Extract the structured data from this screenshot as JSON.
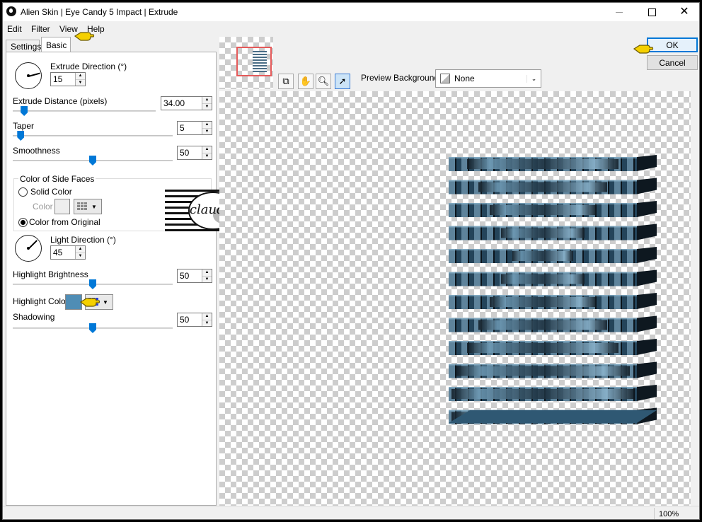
{
  "window": {
    "title": "Alien Skin | Eye Candy 5 Impact | Extrude"
  },
  "menu": [
    "Edit",
    "Filter",
    "View",
    "Help"
  ],
  "tabs": {
    "settings": "Settings",
    "basic": "Basic"
  },
  "controls": {
    "extrude_direction": {
      "label": "Extrude Direction (°)",
      "value": "15",
      "angle_degrees": 15
    },
    "extrude_distance": {
      "label": "Extrude Distance (pixels)",
      "value": "34.00",
      "slider_fraction": 0.08
    },
    "taper": {
      "label": "Taper",
      "value": "5",
      "slider_fraction": 0.05
    },
    "smoothness": {
      "label": "Smoothness",
      "value": "50",
      "slider_fraction": 0.5
    },
    "side_faces": {
      "group_label": "Color of Side Faces",
      "solid_label": "Solid Color",
      "color_label": "Color",
      "original_label": "Color from Original",
      "selected": "original",
      "solid_color": "#eeeeee"
    },
    "light_direction": {
      "label": "Light Direction (°)",
      "value": "45",
      "angle_degrees": 45
    },
    "highlight_brightness": {
      "label": "Highlight Brightness",
      "value": "50",
      "slider_fraction": 0.5
    },
    "highlight_color": {
      "label": "Highlight Color",
      "color": "#4f8db5"
    },
    "shadowing": {
      "label": "Shadowing",
      "value": "50",
      "slider_fraction": 0.5
    }
  },
  "watermark": {
    "text": "claudia"
  },
  "preview": {
    "background_label": "Preview Background:",
    "background_value": "None",
    "tools": [
      "preview-toggle-icon",
      "hand-icon",
      "zoom-icon",
      "pointer-icon"
    ],
    "object_colors": {
      "dark": "#0e1820",
      "mid": "#2f5873",
      "light": "#8db6cf"
    }
  },
  "buttons": {
    "ok": "OK",
    "cancel": "Cancel"
  },
  "status": {
    "zoom": "100%"
  }
}
